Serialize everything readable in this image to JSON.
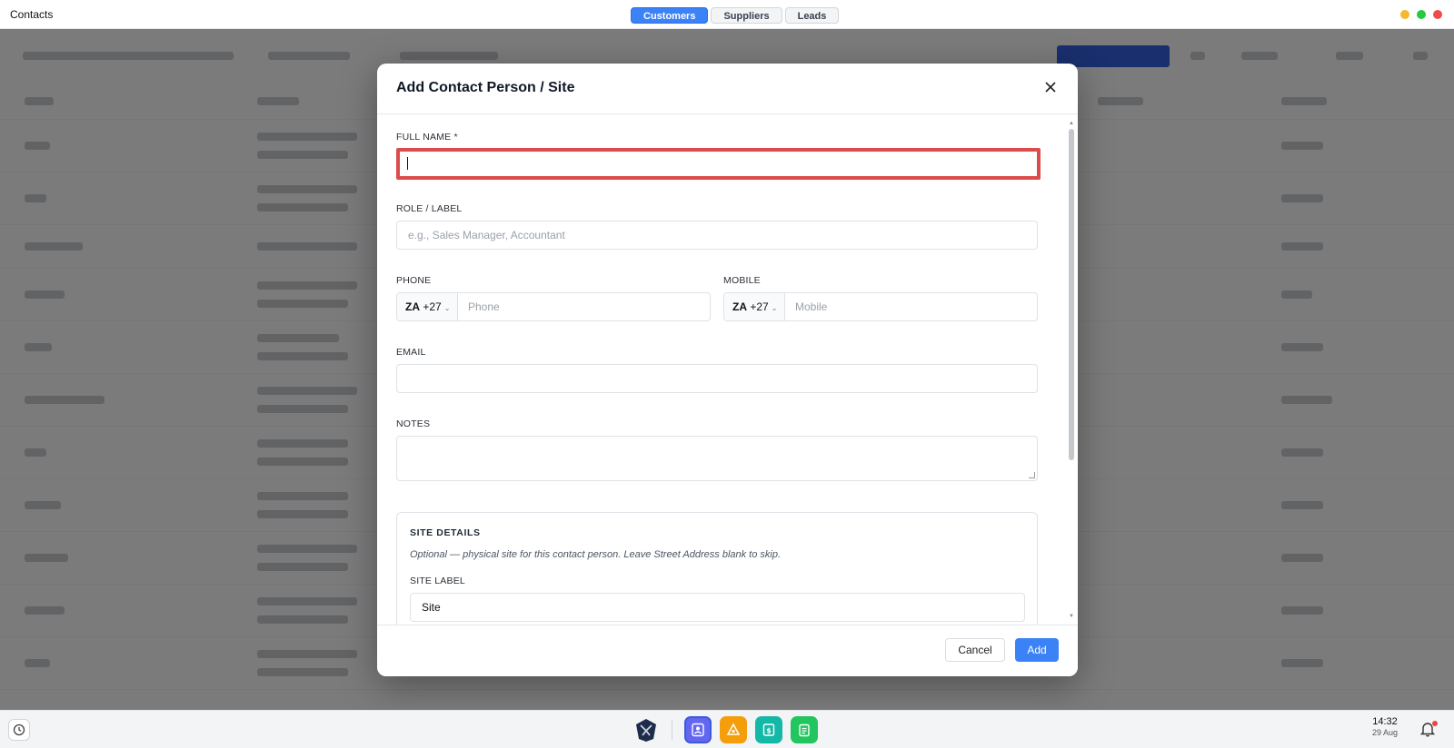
{
  "window": {
    "title": "Contacts",
    "tabs": [
      {
        "label": "Customers",
        "active": true
      },
      {
        "label": "Suppliers",
        "active": false
      },
      {
        "label": "Leads",
        "active": false
      }
    ],
    "controls_colors": [
      "#f5b82e",
      "#28c840",
      "#f04b4b"
    ]
  },
  "modal": {
    "title": "Add Contact Person / Site",
    "full_name": {
      "label": "FULL NAME *",
      "value": ""
    },
    "role": {
      "label": "ROLE / LABEL",
      "placeholder": "e.g., Sales Manager, Accountant"
    },
    "phone": {
      "label": "PHONE",
      "country": "ZA",
      "code": "+27",
      "placeholder": "Phone"
    },
    "mobile": {
      "label": "MOBILE",
      "country": "ZA",
      "code": "+27",
      "placeholder": "Mobile"
    },
    "email": {
      "label": "EMAIL",
      "value": ""
    },
    "notes": {
      "label": "NOTES",
      "value": ""
    },
    "site": {
      "heading": "SITE DETAILS",
      "note": "Optional — physical site for this contact person. Leave Street Address blank to skip.",
      "label_field": {
        "label": "SITE LABEL",
        "value": "Site"
      }
    },
    "cancel_label": "Cancel",
    "add_label": "Add"
  },
  "dock": {
    "time": "14:32",
    "date": "29 Aug",
    "icons": [
      "history-icon",
      "app-logo-icon",
      "contacts-app-icon",
      "projects-app-icon",
      "spreadsheet-app-icon",
      "notes-app-icon",
      "bell-icon"
    ]
  },
  "colors": {
    "accent": "#3b82f6",
    "focus_ring": "#dc4c4c"
  }
}
